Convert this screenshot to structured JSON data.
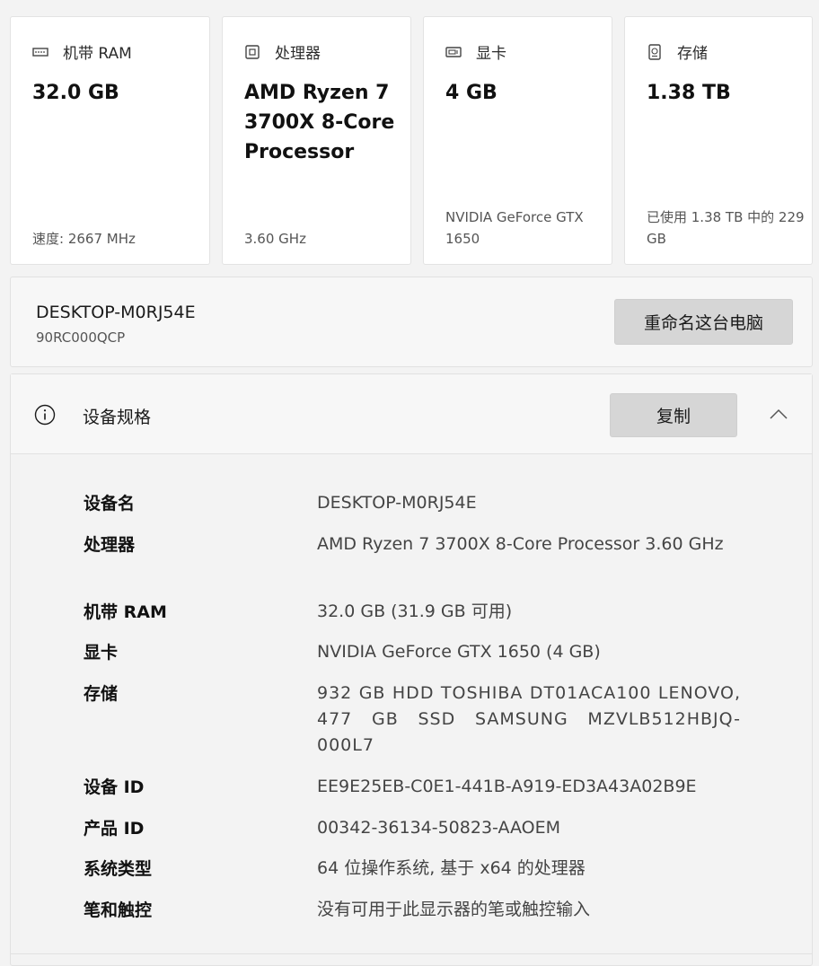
{
  "cards": [
    {
      "label": "机带 RAM",
      "icon": "ram-icon",
      "value": "32.0 GB",
      "foot": "速度: 2667 MHz"
    },
    {
      "label": "处理器",
      "icon": "processor-icon",
      "value": "AMD Ryzen 7 3700X 8-Core Processor",
      "foot": "3.60 GHz"
    },
    {
      "label": "显卡",
      "icon": "gpu-icon",
      "value": "4 GB",
      "foot": "NVIDIA GeForce GTX 1650"
    },
    {
      "label": "存储",
      "icon": "storage-icon",
      "value": "1.38 TB",
      "foot": "已使用 1.38 TB 中的 229 GB"
    }
  ],
  "device": {
    "name": "DESKTOP-M0RJ54E",
    "model": "90RC000QCP",
    "rename_label": "重命名这台电脑"
  },
  "specs": {
    "title": "设备规格",
    "copy_label": "复制",
    "rows": [
      {
        "key": "设备名",
        "value": "DESKTOP-M0RJ54E"
      },
      {
        "key": "处理器",
        "value": "AMD Ryzen 7 3700X 8-Core Processor 3.60 GHz"
      },
      {
        "key": "机带 RAM",
        "value": "32.0 GB (31.9 GB 可用)"
      },
      {
        "key": "显卡",
        "value": "NVIDIA GeForce GTX 1650 (4 GB)"
      },
      {
        "key": "存储",
        "value": "932 GB HDD TOSHIBA DT01ACA100 LENOVO, 477 GB SSD SAMSUNG MZVLB512HBJQ-000L7"
      },
      {
        "key": "设备 ID",
        "value": "EE9E25EB-C0E1-441B-A919-ED3A43A02B9E"
      },
      {
        "key": "产品 ID",
        "value": "00342-36134-50823-AAOEM"
      },
      {
        "key": "系统类型",
        "value": "64 位操作系统, 基于 x64 的处理器"
      },
      {
        "key": "笔和触控",
        "value": "没有可用于此显示器的笔或触控输入"
      }
    ]
  }
}
